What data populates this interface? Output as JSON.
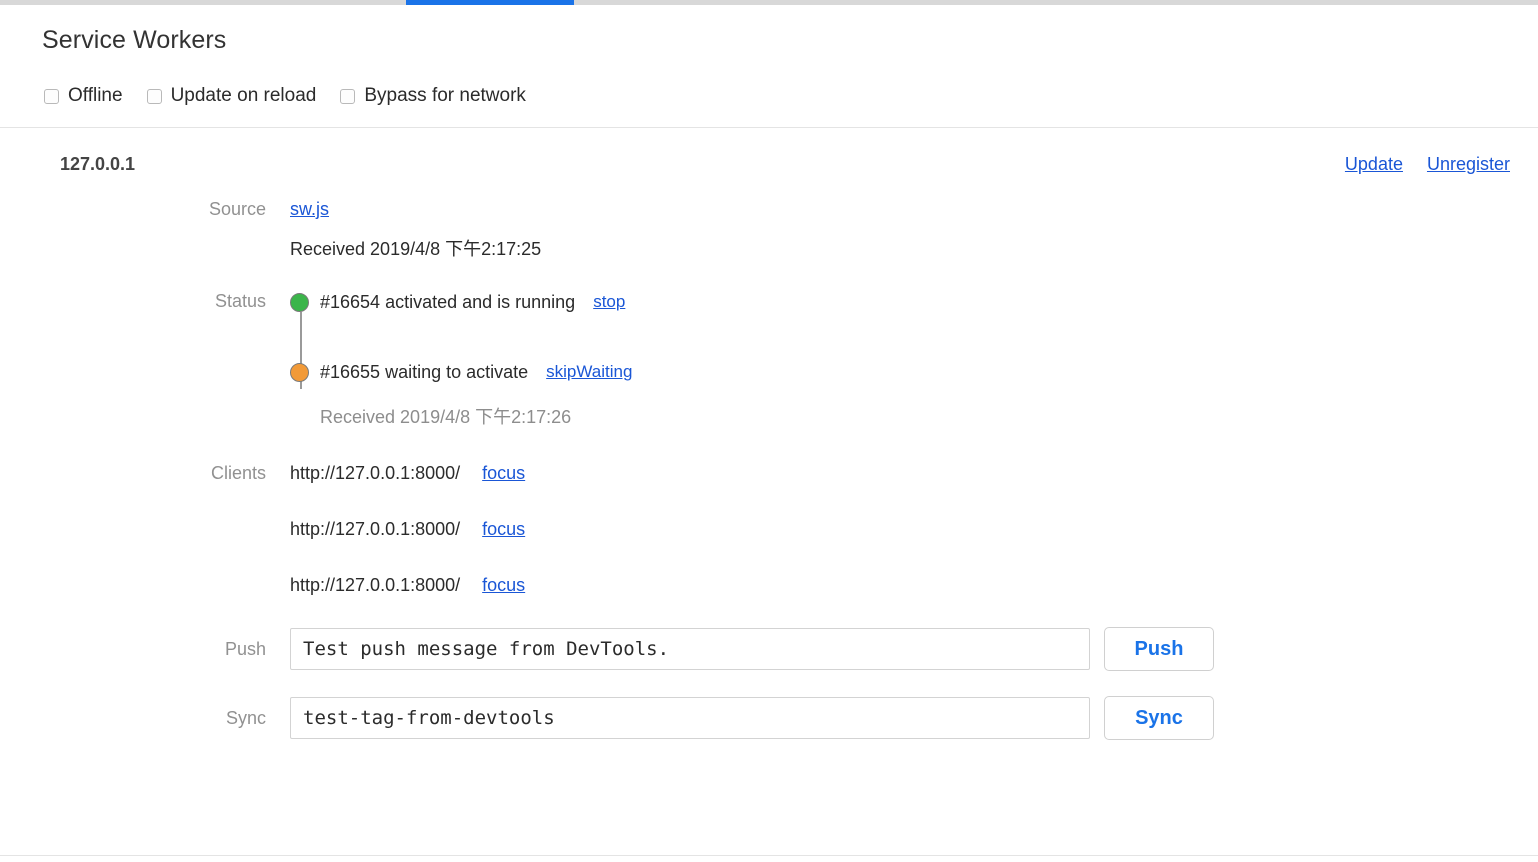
{
  "tabstrip": {
    "active_tab_accent": "#1a73e8"
  },
  "header": {
    "title": "Service Workers",
    "options": [
      {
        "label": "Offline",
        "checked": false
      },
      {
        "label": "Update on reload",
        "checked": false
      },
      {
        "label": "Bypass for network",
        "checked": false
      }
    ]
  },
  "registration": {
    "scope": "127.0.0.1",
    "actions": [
      {
        "label": "Update"
      },
      {
        "label": "Unregister"
      }
    ],
    "source": {
      "label": "Source",
      "file": "sw.js",
      "received": "Received 2019/4/8 下午2:17:25"
    },
    "status": {
      "label": "Status",
      "versions": [
        {
          "id": "#16654",
          "text": "#16654 activated and is running",
          "action": "stop",
          "color": "#3bb54a"
        },
        {
          "id": "#16655",
          "text": "#16655 waiting to activate",
          "action": "skipWaiting",
          "color": "#f29a38"
        }
      ],
      "received": "Received 2019/4/8 下午2:17:26"
    },
    "clients": {
      "label": "Clients",
      "items": [
        {
          "url": "http://127.0.0.1:8000/",
          "action": "focus"
        },
        {
          "url": "http://127.0.0.1:8000/",
          "action": "focus"
        },
        {
          "url": "http://127.0.0.1:8000/",
          "action": "focus"
        }
      ]
    },
    "push": {
      "label": "Push",
      "value": "Test push message from DevTools.",
      "placeholder": "Test push message from DevTools.",
      "button": "Push"
    },
    "sync": {
      "label": "Sync",
      "value": "test-tag-from-devtools",
      "placeholder": "test-tag-from-devtools",
      "button": "Sync"
    }
  }
}
